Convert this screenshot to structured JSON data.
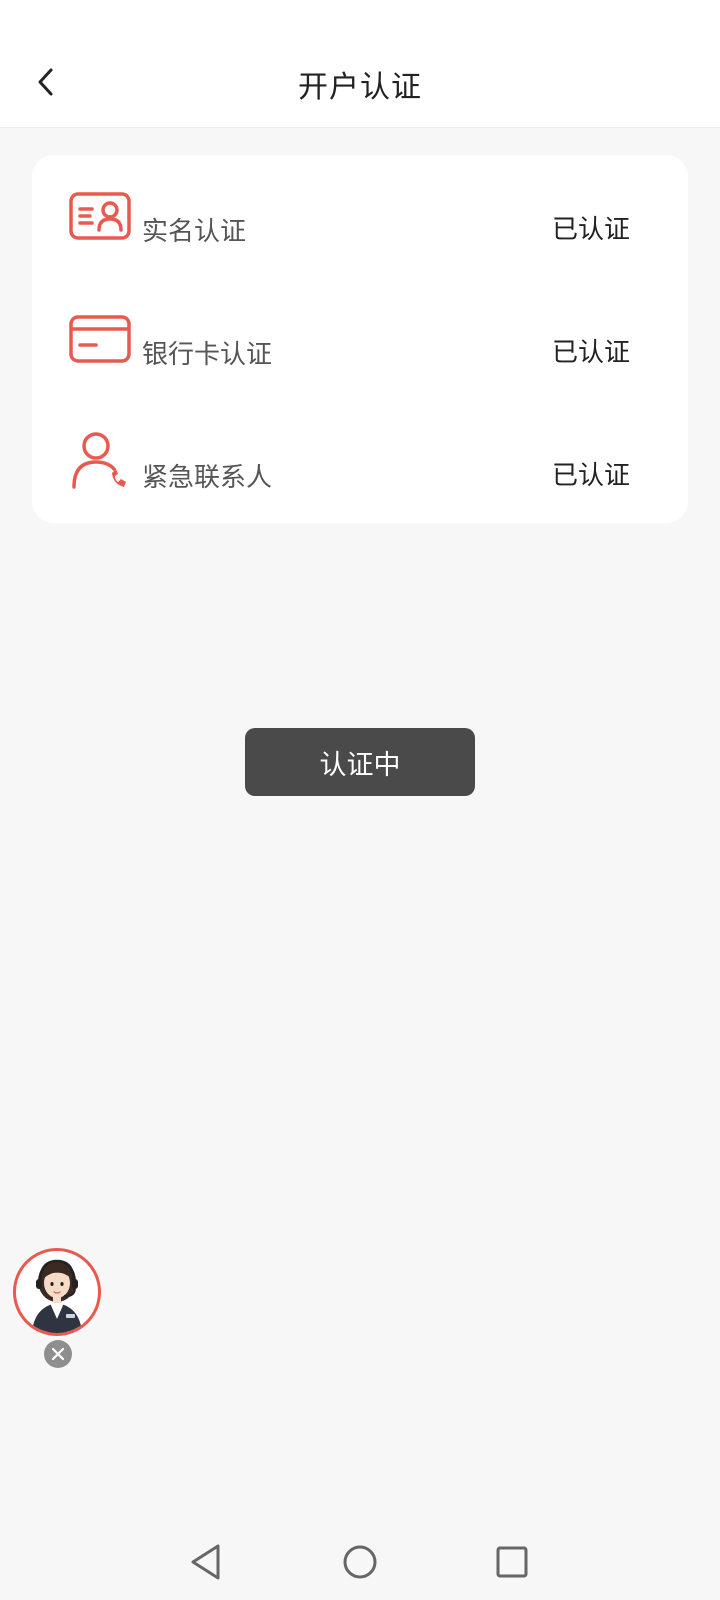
{
  "header": {
    "title": "开户认证",
    "back_icon": "chevron-left-icon"
  },
  "auth_items": [
    {
      "icon": "id-card-icon",
      "label": "实名认证",
      "status": "已认证"
    },
    {
      "icon": "bank-card-icon",
      "label": "银行卡认证",
      "status": "已认证"
    },
    {
      "icon": "emergency-contact-icon",
      "label": "紧急联系人",
      "status": "已认证"
    }
  ],
  "main_button": {
    "label": "认证中"
  },
  "support": {
    "icon": "customer-service-avatar",
    "close_icon": "close-icon"
  },
  "nav": {
    "back_icon": "nav-back-icon",
    "home_icon": "nav-home-icon",
    "recents_icon": "nav-recents-icon"
  },
  "colors": {
    "accent": "#e85a4f",
    "button_bg": "#4a4a4a",
    "page_bg": "#f7f7f7"
  }
}
